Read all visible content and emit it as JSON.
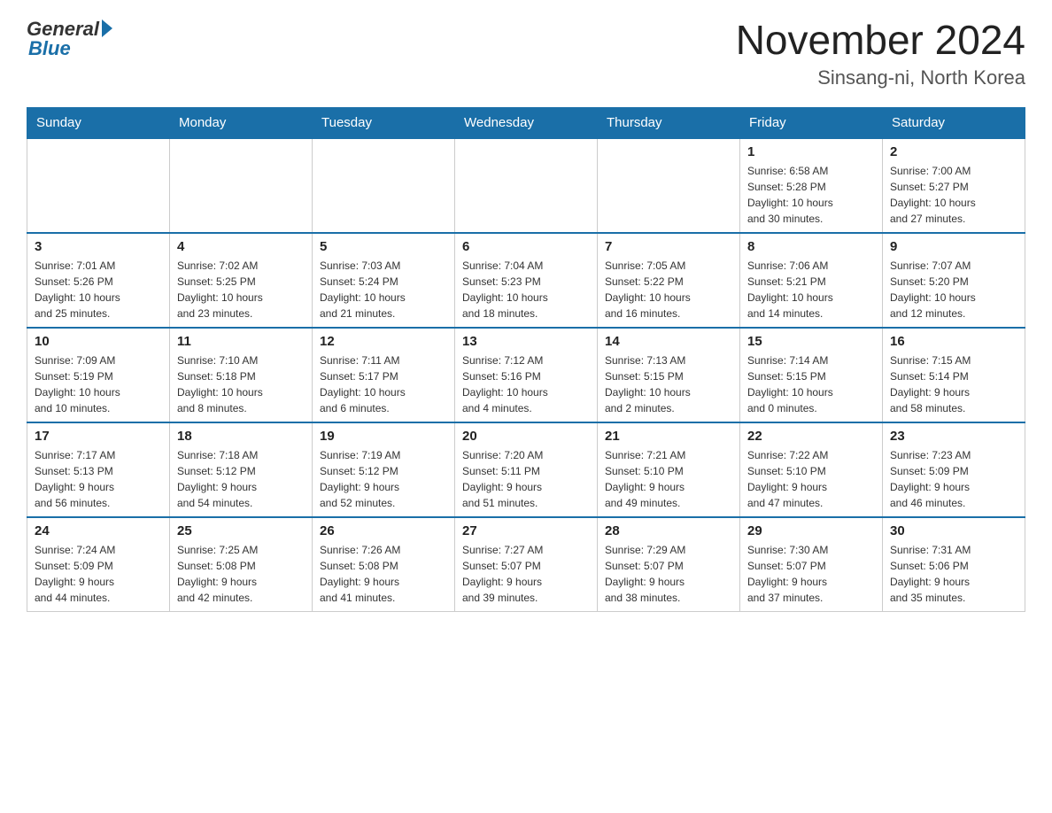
{
  "header": {
    "logo": {
      "general": "General",
      "blue": "Blue"
    },
    "title": "November 2024",
    "location": "Sinsang-ni, North Korea"
  },
  "weekdays": [
    "Sunday",
    "Monday",
    "Tuesday",
    "Wednesday",
    "Thursday",
    "Friday",
    "Saturday"
  ],
  "weeks": [
    [
      {
        "day": "",
        "info": ""
      },
      {
        "day": "",
        "info": ""
      },
      {
        "day": "",
        "info": ""
      },
      {
        "day": "",
        "info": ""
      },
      {
        "day": "",
        "info": ""
      },
      {
        "day": "1",
        "info": "Sunrise: 6:58 AM\nSunset: 5:28 PM\nDaylight: 10 hours\nand 30 minutes."
      },
      {
        "day": "2",
        "info": "Sunrise: 7:00 AM\nSunset: 5:27 PM\nDaylight: 10 hours\nand 27 minutes."
      }
    ],
    [
      {
        "day": "3",
        "info": "Sunrise: 7:01 AM\nSunset: 5:26 PM\nDaylight: 10 hours\nand 25 minutes."
      },
      {
        "day": "4",
        "info": "Sunrise: 7:02 AM\nSunset: 5:25 PM\nDaylight: 10 hours\nand 23 minutes."
      },
      {
        "day": "5",
        "info": "Sunrise: 7:03 AM\nSunset: 5:24 PM\nDaylight: 10 hours\nand 21 minutes."
      },
      {
        "day": "6",
        "info": "Sunrise: 7:04 AM\nSunset: 5:23 PM\nDaylight: 10 hours\nand 18 minutes."
      },
      {
        "day": "7",
        "info": "Sunrise: 7:05 AM\nSunset: 5:22 PM\nDaylight: 10 hours\nand 16 minutes."
      },
      {
        "day": "8",
        "info": "Sunrise: 7:06 AM\nSunset: 5:21 PM\nDaylight: 10 hours\nand 14 minutes."
      },
      {
        "day": "9",
        "info": "Sunrise: 7:07 AM\nSunset: 5:20 PM\nDaylight: 10 hours\nand 12 minutes."
      }
    ],
    [
      {
        "day": "10",
        "info": "Sunrise: 7:09 AM\nSunset: 5:19 PM\nDaylight: 10 hours\nand 10 minutes."
      },
      {
        "day": "11",
        "info": "Sunrise: 7:10 AM\nSunset: 5:18 PM\nDaylight: 10 hours\nand 8 minutes."
      },
      {
        "day": "12",
        "info": "Sunrise: 7:11 AM\nSunset: 5:17 PM\nDaylight: 10 hours\nand 6 minutes."
      },
      {
        "day": "13",
        "info": "Sunrise: 7:12 AM\nSunset: 5:16 PM\nDaylight: 10 hours\nand 4 minutes."
      },
      {
        "day": "14",
        "info": "Sunrise: 7:13 AM\nSunset: 5:15 PM\nDaylight: 10 hours\nand 2 minutes."
      },
      {
        "day": "15",
        "info": "Sunrise: 7:14 AM\nSunset: 5:15 PM\nDaylight: 10 hours\nand 0 minutes."
      },
      {
        "day": "16",
        "info": "Sunrise: 7:15 AM\nSunset: 5:14 PM\nDaylight: 9 hours\nand 58 minutes."
      }
    ],
    [
      {
        "day": "17",
        "info": "Sunrise: 7:17 AM\nSunset: 5:13 PM\nDaylight: 9 hours\nand 56 minutes."
      },
      {
        "day": "18",
        "info": "Sunrise: 7:18 AM\nSunset: 5:12 PM\nDaylight: 9 hours\nand 54 minutes."
      },
      {
        "day": "19",
        "info": "Sunrise: 7:19 AM\nSunset: 5:12 PM\nDaylight: 9 hours\nand 52 minutes."
      },
      {
        "day": "20",
        "info": "Sunrise: 7:20 AM\nSunset: 5:11 PM\nDaylight: 9 hours\nand 51 minutes."
      },
      {
        "day": "21",
        "info": "Sunrise: 7:21 AM\nSunset: 5:10 PM\nDaylight: 9 hours\nand 49 minutes."
      },
      {
        "day": "22",
        "info": "Sunrise: 7:22 AM\nSunset: 5:10 PM\nDaylight: 9 hours\nand 47 minutes."
      },
      {
        "day": "23",
        "info": "Sunrise: 7:23 AM\nSunset: 5:09 PM\nDaylight: 9 hours\nand 46 minutes."
      }
    ],
    [
      {
        "day": "24",
        "info": "Sunrise: 7:24 AM\nSunset: 5:09 PM\nDaylight: 9 hours\nand 44 minutes."
      },
      {
        "day": "25",
        "info": "Sunrise: 7:25 AM\nSunset: 5:08 PM\nDaylight: 9 hours\nand 42 minutes."
      },
      {
        "day": "26",
        "info": "Sunrise: 7:26 AM\nSunset: 5:08 PM\nDaylight: 9 hours\nand 41 minutes."
      },
      {
        "day": "27",
        "info": "Sunrise: 7:27 AM\nSunset: 5:07 PM\nDaylight: 9 hours\nand 39 minutes."
      },
      {
        "day": "28",
        "info": "Sunrise: 7:29 AM\nSunset: 5:07 PM\nDaylight: 9 hours\nand 38 minutes."
      },
      {
        "day": "29",
        "info": "Sunrise: 7:30 AM\nSunset: 5:07 PM\nDaylight: 9 hours\nand 37 minutes."
      },
      {
        "day": "30",
        "info": "Sunrise: 7:31 AM\nSunset: 5:06 PM\nDaylight: 9 hours\nand 35 minutes."
      }
    ]
  ]
}
